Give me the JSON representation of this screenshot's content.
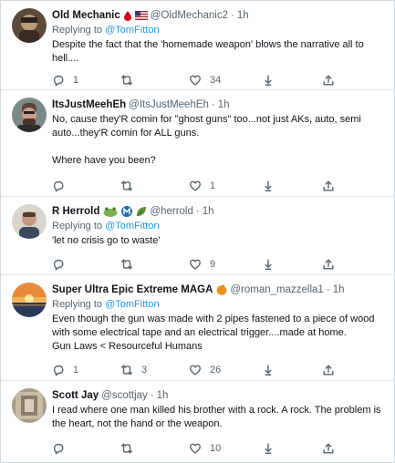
{
  "tweets": [
    {
      "name": "Old Mechanic",
      "handle": "@OldMechanic2",
      "sep": "·",
      "time": "1h",
      "replying_prefix": "Replying to",
      "replying_to": "@TomFitton",
      "lines": [
        "Despite the fact that the 'homemade weapon' blows the narrative all to",
        "hell...."
      ],
      "reply_count": "1",
      "retweet_count": "",
      "like_count": "34"
    },
    {
      "name": "ItsJustMeehEh",
      "handle": "@ItsJustMeehEh",
      "sep": "·",
      "time": "1h",
      "lines": [
        "No, cause they'R comin for \"ghost guns\" too...not just AKs, auto, semi",
        "auto...they'R comin for ALL guns.",
        "",
        "Where have you been?"
      ],
      "reply_count": "",
      "retweet_count": "",
      "like_count": "1"
    },
    {
      "name": "R Herrold",
      "handle": "@herrold",
      "sep": "·",
      "time": "1h",
      "replying_prefix": "Replying to",
      "replying_to": "@TomFitton",
      "lines": [
        "'let no crisis go to waste'"
      ],
      "reply_count": "",
      "retweet_count": "",
      "like_count": "9"
    },
    {
      "name": "Super Ultra Epic Extreme MAGA",
      "handle": "@roman_mazzella1",
      "sep": "·",
      "time": "1h",
      "replying_prefix": "Replying to",
      "replying_to": "@TomFitton",
      "lines": [
        "Even though the gun was made with 2 pipes fastened to a piece of wood",
        "with some electrical tape and an electrical trigger....made at home.",
        "Gun Laws < Resourceful Humans"
      ],
      "reply_count": "1",
      "retweet_count": "3",
      "like_count": "26"
    },
    {
      "name": "Scott Jay",
      "handle": "@scottjay",
      "sep": "·",
      "time": "1h",
      "lines": [
        "I read where one man killed his brother with a rock. A rock. The problem is",
        "the heart, not the hand or the weapon."
      ],
      "reply_count": "",
      "retweet_count": "",
      "like_count": "10"
    }
  ],
  "icons": {
    "reply": "reply-icon",
    "retweet": "retweet-icon",
    "like": "heart-icon",
    "share": "share-icon",
    "more": "more-icon"
  },
  "colors": {
    "link": "#1d9bf0",
    "text": "#0f1419",
    "muted": "#536471"
  }
}
